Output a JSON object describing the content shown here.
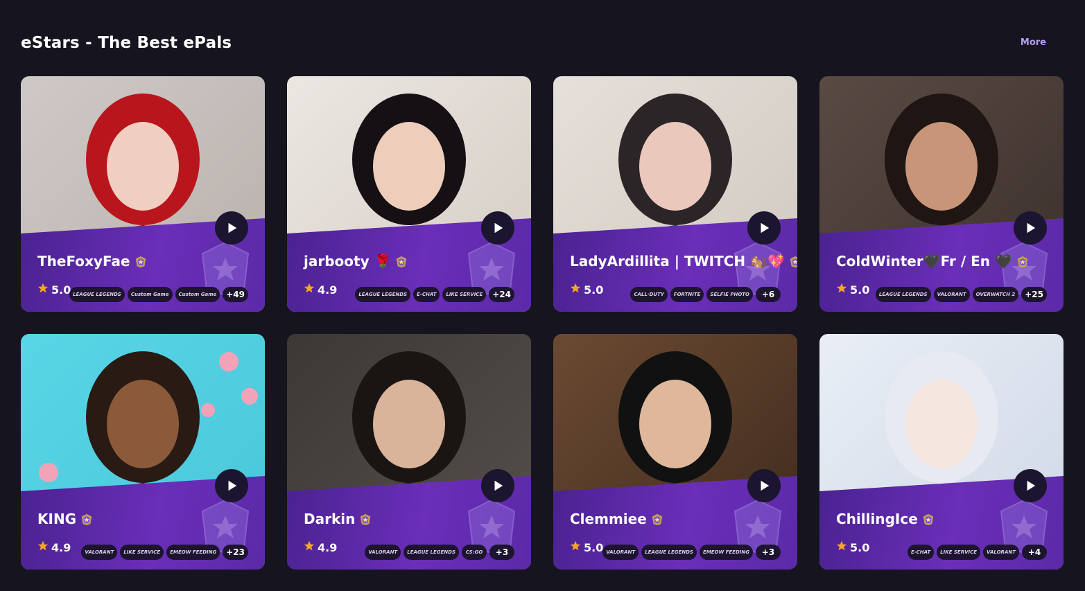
{
  "header": {
    "title": "eStars - The Best ePals",
    "more_label": "More"
  },
  "colors": {
    "background": "#15141f",
    "panel": "#6a2eb8",
    "accent": "#b69cf0",
    "star": "#f5a524"
  },
  "cards": [
    {
      "name": "TheFoxyFae",
      "rating": "5.0",
      "tags": [
        "LEAGUE LEGENDS",
        "Custom Game",
        "Custom Game"
      ],
      "more": "+49"
    },
    {
      "name": "jarbooty 🌹",
      "rating": "4.9",
      "tags": [
        "LEAGUE LEGENDS",
        "E-CHAT",
        "LIKE SERVICE"
      ],
      "more": "+24"
    },
    {
      "name": "LadyArdillita | TWITCH 🐿️💖",
      "rating": "5.0",
      "tags": [
        "CALL·DUTY",
        "FORTNITE",
        "SELFIE PHOTO"
      ],
      "more": "+6"
    },
    {
      "name": "ColdWinter🖤Fr / En 🖤",
      "rating": "5.0",
      "tags": [
        "LEAGUE LEGENDS",
        "VALORANT",
        "OVERWATCH 2"
      ],
      "more": "+25"
    },
    {
      "name": "KING",
      "rating": "4.9",
      "tags": [
        "VALORANT",
        "LIKE SERVICE",
        "EMEOW FEEDING"
      ],
      "more": "+23"
    },
    {
      "name": "Darkin",
      "rating": "4.9",
      "tags": [
        "VALORANT",
        "LEAGUE LEGENDS",
        "CS:GO"
      ],
      "more": "+3"
    },
    {
      "name": "Clemmiee",
      "rating": "5.0",
      "tags": [
        "VALORANT",
        "LEAGUE LEGENDS",
        "EMEOW FEEDING"
      ],
      "more": "+3"
    },
    {
      "name": "ChillingIce",
      "rating": "5.0",
      "tags": [
        "E-CHAT",
        "LIKE SERVICE",
        "VALORANT"
      ],
      "more": "+4"
    }
  ]
}
